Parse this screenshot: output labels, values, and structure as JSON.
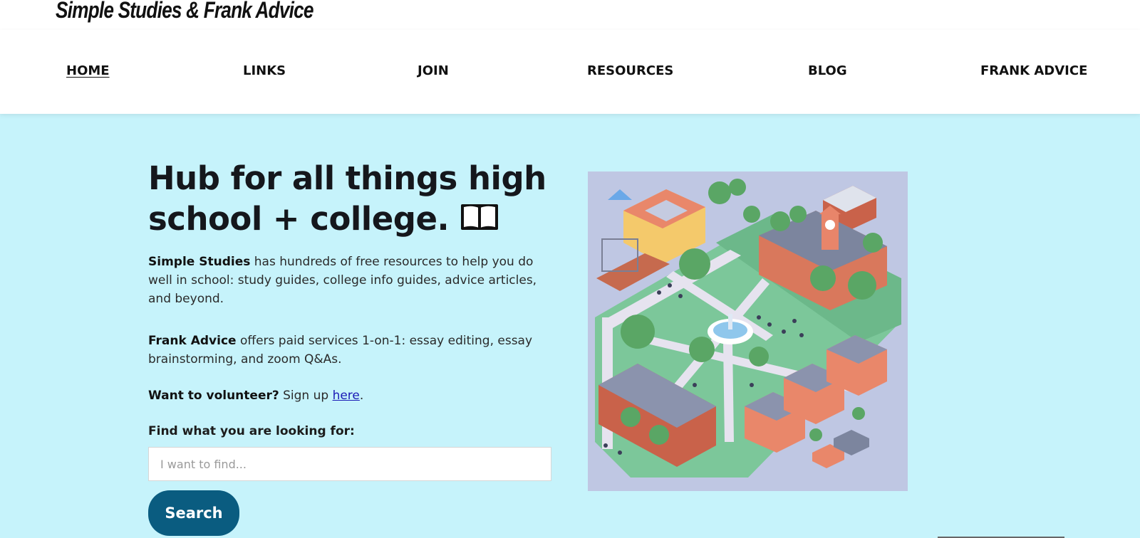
{
  "header": {
    "logo_text": "Simple Studies & Frank Advice"
  },
  "nav": {
    "items": [
      {
        "label": "HOME",
        "active": true
      },
      {
        "label": "LINKS"
      },
      {
        "label": "JOIN"
      },
      {
        "label": "RESOURCES"
      },
      {
        "label": "BLOG"
      },
      {
        "label": "FRANK ADVICE"
      }
    ]
  },
  "hero": {
    "headline": "Hub for all things high school + college.",
    "headline_icon": "open-book-emoji",
    "simple_studies_bold": "Simple Studies",
    "simple_studies_text": " has hundreds of free resources to help you do well in school: study guides, college info guides, advice articles, and beyond.",
    "frank_advice_bold": "Frank Advice",
    "frank_advice_text": " offers paid services 1-on-1: essay editing, essay brainstorming, and zoom Q&As.",
    "volunteer_bold": "Want to volunteer?",
    "volunteer_text": " Sign up ",
    "volunteer_link": "here",
    "volunteer_end": "."
  },
  "search": {
    "label": "Find what you are looking for:",
    "placeholder": "I want to find...",
    "value": "",
    "button_label": "Search"
  },
  "illustration": {
    "icon": "campus-illustration"
  },
  "colors": {
    "page_background": "#c6f3fb",
    "button": "#0a5c80",
    "illustration_bg": "#bfc7e3",
    "lawn": "#7cc79a",
    "brick": "#e08b6c"
  }
}
